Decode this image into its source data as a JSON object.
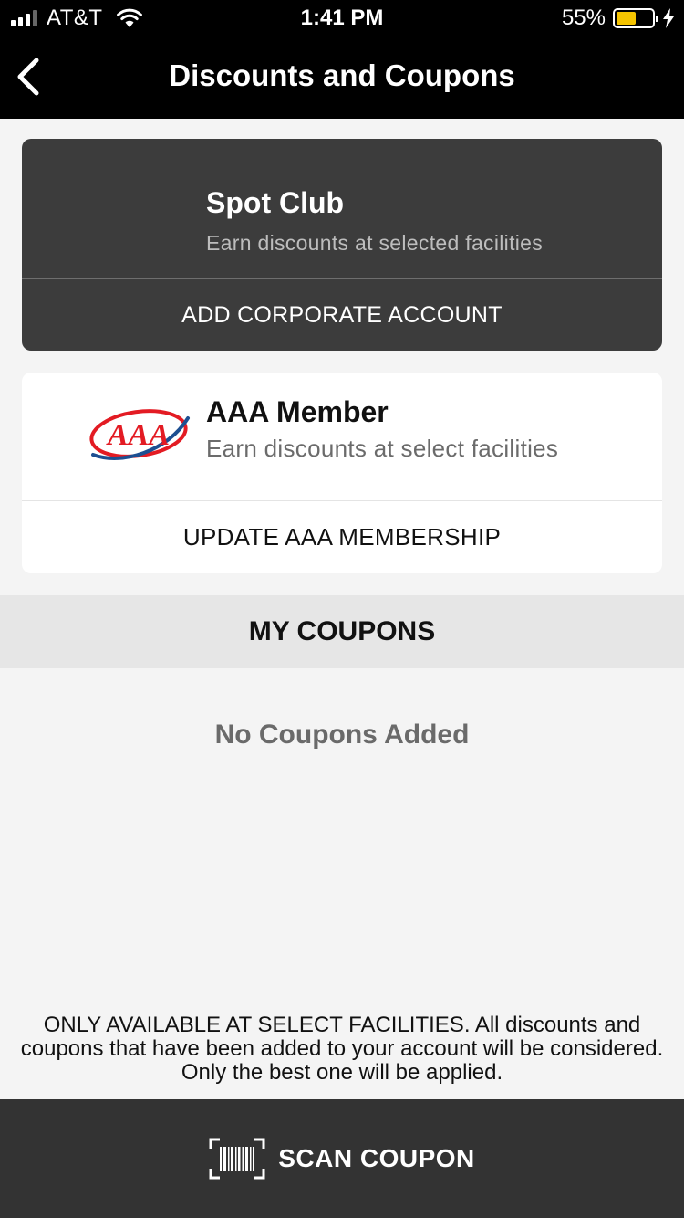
{
  "status_bar": {
    "carrier": "AT&T",
    "time": "1:41 PM",
    "battery_percent": "55%",
    "battery_level": 0.55,
    "signal_bars_on": 3,
    "signal_bars_total": 4,
    "battery_color": "#f5c400"
  },
  "nav": {
    "title": "Discounts and Coupons",
    "back_icon": "chevron-left-icon"
  },
  "spot_club": {
    "title": "Spot Club",
    "subtitle": "Earn discounts at selected facilities",
    "action_label": "ADD CORPORATE ACCOUNT"
  },
  "aaa": {
    "logo_text": "AAA",
    "title": "AAA Member",
    "subtitle": "Earn discounts at select facilities",
    "action_label": "UPDATE AAA MEMBERSHIP"
  },
  "coupons": {
    "section_title": "MY COUPONS",
    "empty_text": "No Coupons Added"
  },
  "disclaimer": "ONLY AVAILABLE AT SELECT FACILITIES. All discounts and coupons that have been added to your account will be considered. Only the best one will be applied.",
  "scan": {
    "label": "SCAN COUPON",
    "icon": "barcode-scan-icon"
  },
  "colors": {
    "header_bg": "#000000",
    "card_dark_bg": "#3c3c3c",
    "scanbar_bg": "#333333",
    "aaa_red": "#e31b23",
    "aaa_blue": "#1d4f91"
  }
}
